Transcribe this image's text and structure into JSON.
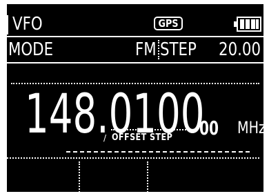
{
  "header": {
    "title": "VFO",
    "gps_label": "GPS",
    "battery_icon": "battery-full-icon"
  },
  "status_row": {
    "mode_label": "MODE",
    "mode_value": "FM",
    "step_label": "STEP",
    "step_value": "20.00"
  },
  "frequency": {
    "main": "148.0100",
    "sub_digits": "00",
    "unit": "MHz",
    "offset_slash": "/",
    "offset_label": "OFFSET STEP"
  },
  "colors": {
    "screen_bg": "#000000",
    "foreground": "#ffffff"
  }
}
